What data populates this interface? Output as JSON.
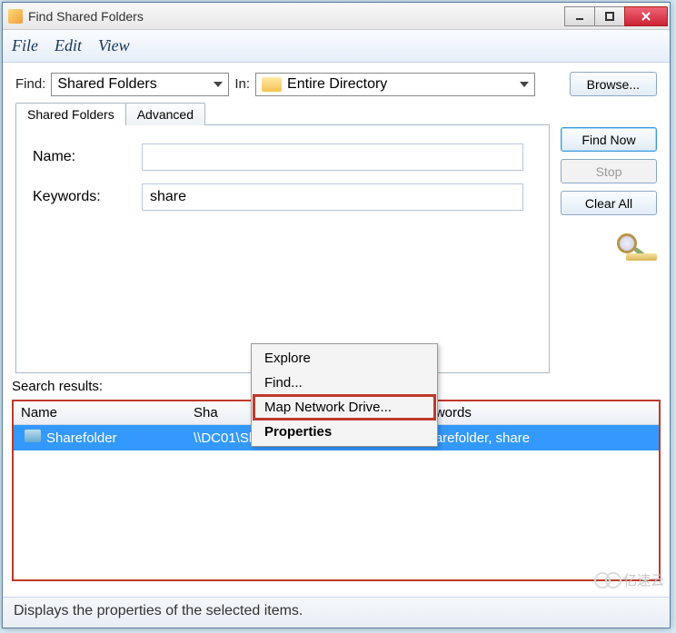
{
  "title": "Find Shared Folders",
  "menu": {
    "file": "File",
    "edit": "Edit",
    "view": "View"
  },
  "toolbar": {
    "find_label": "Find:",
    "find_value": "Shared Folders",
    "in_label": "In:",
    "in_value": "Entire Directory",
    "browse": "Browse..."
  },
  "tabs": {
    "shared": "Shared Folders",
    "advanced": "Advanced"
  },
  "form": {
    "name_label": "Name:",
    "name_value": "",
    "keywords_label": "Keywords:",
    "keywords_value": "share"
  },
  "side": {
    "find_now": "Find Now",
    "stop": "Stop",
    "clear_all": "Clear All"
  },
  "search_results_label": "Search results:",
  "columns": {
    "name": "Name",
    "share": "Sha",
    "keywords": "eywords"
  },
  "rows": [
    {
      "name": "Sharefolder",
      "share": "\\\\DC01\\Sharefolder",
      "keywords": "sharefolder, share"
    }
  ],
  "context_menu": {
    "explore": "Explore",
    "find": "Find...",
    "map": "Map Network Drive...",
    "properties": "Properties"
  },
  "status": "Displays the properties of the selected items.",
  "watermark": "亿速云"
}
